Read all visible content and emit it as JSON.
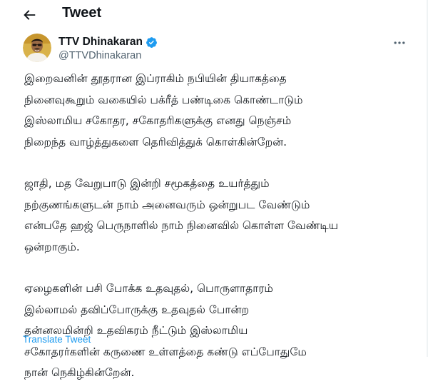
{
  "header": {
    "title": "Tweet",
    "back_icon": "arrow-left-icon"
  },
  "author": {
    "display_name": "TTV Dhinakaran",
    "handle": "@TTVDhinakaran",
    "verified_icon": "verified-badge-icon",
    "verified_color": "#1d9bf0"
  },
  "tweet": {
    "paragraphs": [
      "இறைவனின் தூதரான இப்ராகிம் நபியின் தியாகத்தை\nநினைவுகூறும் வகையில் பக்ரீத் பண்டிகை கொண்டாடும்\nஇஸ்லாமிய சகோதர, சகோதரிகளுக்கு எனது நெஞ்சம்\nநிறைந்த வாழ்த்துகளை தெரிவித்துக் கொள்கின்றேன்.",
      "ஜாதி, மத வேறுபாடு இன்றி சமூகத்தை உயர்த்தும்\nநற்குணங்களுடன் நாம் அனைவரும் ஒன்றுபட வேண்டும்\nஎன்பதே ஹஜ் பெருநாளில் நாம் நினைவில் கொள்ள வேண்டிய\nஒன்றாகும்.",
      "ஏழைகளின் பசி போக்க உதவுதல், பொருளாதாரம்\nஇல்லாமல் தவிப்போருக்கு உதவுதல் போன்ற\nதன்னலமின்றி உதவிகரம் நீட்டும் இஸ்லாமிய\nசகோதரர்களின் கருணை உள்ளத்தை கண்டு எப்போதுமே\nநான் நெகிழ்கின்றேன்."
    ],
    "translate_label": "Translate Tweet"
  },
  "colors": {
    "accent": "#1d9bf0",
    "text": "#0f1419",
    "secondary_text": "#536471"
  }
}
